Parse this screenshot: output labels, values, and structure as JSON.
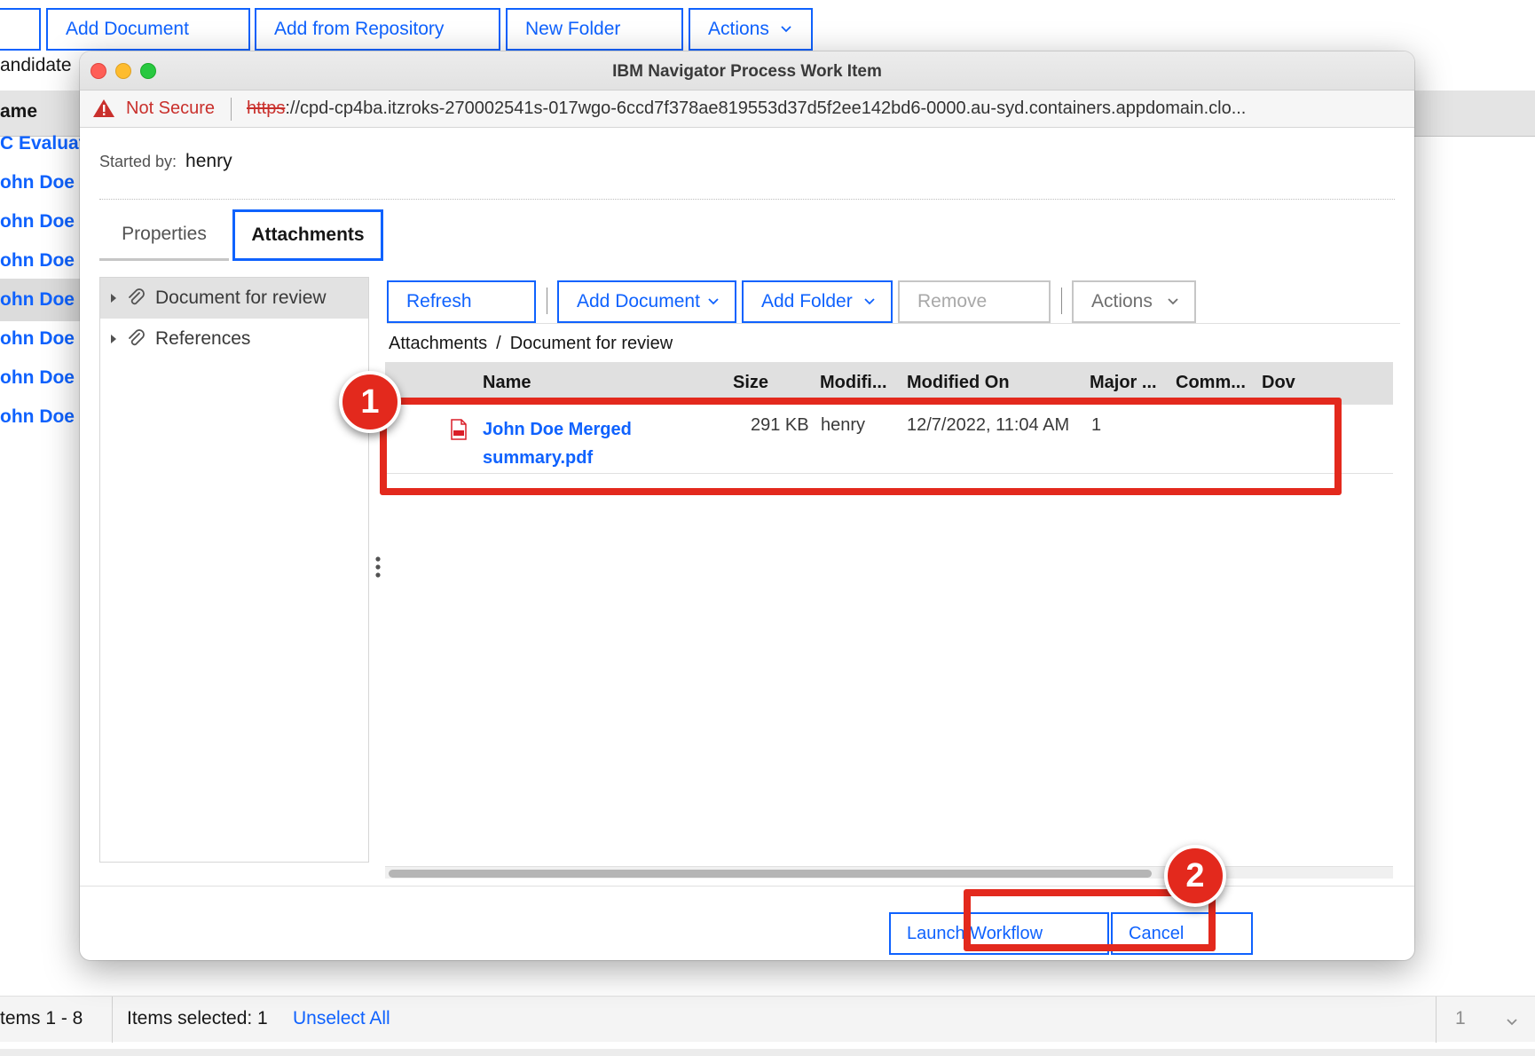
{
  "background": {
    "toolbar": {
      "add_document": "Add Document",
      "add_from_repository": "Add from Repository",
      "new_folder": "New Folder",
      "actions": "Actions"
    },
    "candidate_label": "andidate",
    "column_header": "ame",
    "rows": [
      "C Evaluat",
      "ohn Doe D",
      "ohn Doe D",
      "ohn Doe E",
      "ohn Doe N",
      "ohn Doe F",
      "ohn Doe S",
      "ohn Doe V"
    ],
    "footer": {
      "items_range": "tems 1 - 8",
      "items_selected": "Items selected: 1",
      "unselect_all": "Unselect All",
      "page": "1"
    }
  },
  "window": {
    "title": "IBM Navigator Process Work Item",
    "security_warning": "Not Secure",
    "url_scheme": "https",
    "url_rest": "://cpd-cp4ba.itzroks-270002541s-017wgo-6ccd7f378ae819553d37d5f2ee142bd6-0000.au-syd.containers.appdomain.clo..."
  },
  "dialog": {
    "started_by_label": "Started by:",
    "started_by_value": "henry",
    "tabs": {
      "properties": "Properties",
      "attachments": "Attachments"
    },
    "tree": [
      {
        "label": "Document for review"
      },
      {
        "label": "References"
      }
    ],
    "toolbar": {
      "refresh": "Refresh",
      "add_document": "Add Document",
      "add_folder": "Add Folder",
      "remove": "Remove",
      "actions": "Actions"
    },
    "breadcrumb": {
      "root": "Attachments",
      "separator": "/",
      "current": "Document for review"
    },
    "grid": {
      "headers": {
        "name": "Name",
        "size": "Size",
        "modified_by": "Modifi...",
        "modified_on": "Modified On",
        "major": "Major ...",
        "comment": "Comm...",
        "download": "Dov"
      },
      "rows": [
        {
          "name": "John Doe Merged summary.pdf",
          "size": "291 KB",
          "modified_by": "henry",
          "modified_on": "12/7/2022, 11:04 AM",
          "major": "1"
        }
      ]
    },
    "buttons": {
      "launch_workflow": "Launch Workflow",
      "cancel": "Cancel"
    }
  },
  "annotations": {
    "step1": "1",
    "step2": "2"
  },
  "colors": {
    "accent": "#0f62fe",
    "annotation": "#e3291d",
    "warning": "#c9302c"
  }
}
